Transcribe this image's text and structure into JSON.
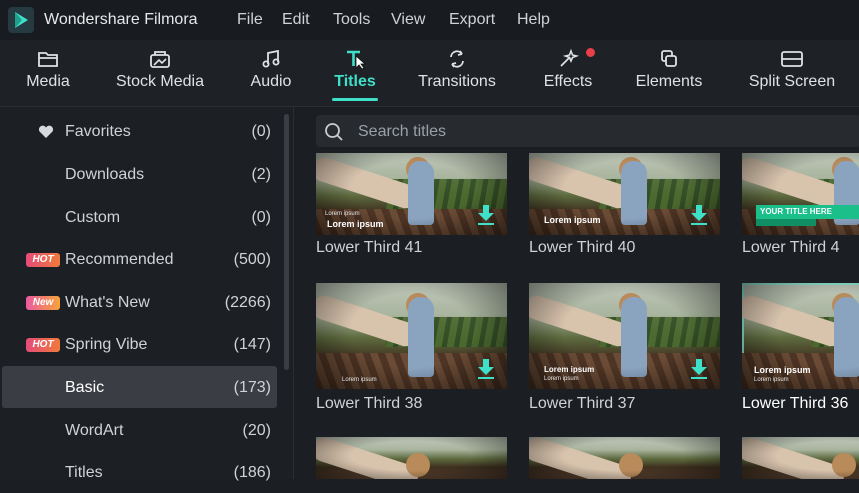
{
  "app": {
    "title": "Wondershare Filmora"
  },
  "menu": [
    "File",
    "Edit",
    "Tools",
    "View",
    "Export",
    "Help"
  ],
  "toolbar": {
    "items": [
      {
        "label": "Media",
        "icon": "folder-icon"
      },
      {
        "label": "Stock Media",
        "icon": "stock-media-icon"
      },
      {
        "label": "Audio",
        "icon": "music-note-icon"
      },
      {
        "label": "Titles",
        "icon": "titles-icon"
      },
      {
        "label": "Transitions",
        "icon": "transitions-icon"
      },
      {
        "label": "Effects",
        "icon": "effects-icon"
      },
      {
        "label": "Elements",
        "icon": "elements-icon"
      },
      {
        "label": "Split Screen",
        "icon": "split-screen-icon"
      }
    ],
    "active": "Titles"
  },
  "sidebar": {
    "items": [
      {
        "name": "Favorites",
        "count": "(0)",
        "badge": "",
        "icon": "heart-icon"
      },
      {
        "name": "Downloads",
        "count": "(2)",
        "badge": ""
      },
      {
        "name": "Custom",
        "count": "(0)",
        "badge": ""
      },
      {
        "name": "Recommended",
        "count": "(500)",
        "badge": "HOT"
      },
      {
        "name": "What's New",
        "count": "(2266)",
        "badge": "New"
      },
      {
        "name": "Spring Vibe",
        "count": "(147)",
        "badge": "HOT"
      },
      {
        "name": "Basic",
        "count": "(173)",
        "badge": "",
        "selected": true
      },
      {
        "name": "WordArt",
        "count": "(20)",
        "badge": ""
      },
      {
        "name": "Titles",
        "count": "(186)",
        "badge": ""
      }
    ]
  },
  "search": {
    "placeholder": "Search titles"
  },
  "grid": {
    "cards": [
      {
        "label": "Lower Third 41",
        "overlay": "Lorem ipsum",
        "overlay_small": "Lorem ipsum"
      },
      {
        "label": "Lower Third 40",
        "overlay": "Lorem ipsum"
      },
      {
        "label": "Lower Third 4",
        "overlay": "YOUR TITLE HERE"
      },
      {
        "label": "Lower Third 38",
        "overlay": "Lorem ipsum"
      },
      {
        "label": "Lower Third 37",
        "overlay": "Lorem ipsum",
        "overlay_small": "Lorem ipsum"
      },
      {
        "label": "Lower Third 36",
        "overlay": "Lorem ipsum",
        "overlay_small": "Lorem ipsum",
        "selected": true
      }
    ]
  },
  "colors": {
    "accent": "#3fe0c8",
    "hot_badge": "#e54b7a",
    "notification": "#e8404a"
  }
}
